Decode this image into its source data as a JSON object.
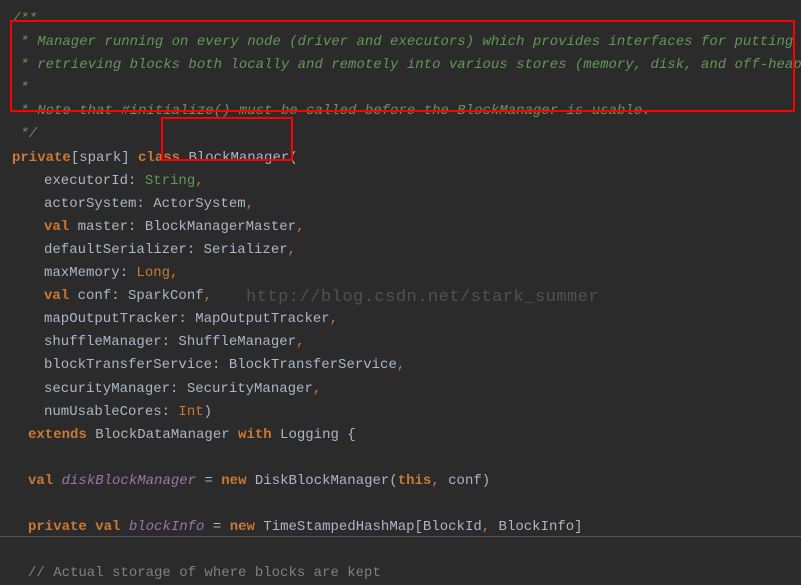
{
  "code": {
    "doc_open": "/**",
    "doc_line1": " * Manager running on every node (driver and executors) which provides interfaces for putting and",
    "doc_line2": " * retrieving blocks both locally and remotely into various stores (memory, disk, and off-heap).",
    "doc_line3": " *",
    "doc_line4": " * Note that #initialize() must be called before the BlockManager is usable.",
    "doc_close": " */",
    "kw_private": "private",
    "spark_scope": "[spark] ",
    "kw_class": "class",
    "class_name": " BlockManager(",
    "param1_name": "executorId: ",
    "param1_type": "String",
    "comma": ",",
    "param2": "actorSystem: ActorSystem",
    "kw_val": "val",
    "param3": " master: BlockManagerMaster",
    "param4": "defaultSerializer: Serializer",
    "param5_name": "maxMemory: ",
    "param5_type": "Long",
    "param6": " conf: SparkConf",
    "param7": "mapOutputTracker: MapOutputTracker",
    "param8": "shuffleManager: ShuffleManager",
    "param9": "blockTransferService: BlockTransferService",
    "param10": "securityManager: SecurityManager",
    "param11_name": "numUsableCores: ",
    "param11_type": "Int",
    "close_paren": ")",
    "kw_extends": "extends",
    "extends_target": " BlockDataManager ",
    "kw_with": "with",
    "with_target": " Logging {",
    "field1_name": "diskBlockManager",
    "equals": " = ",
    "kw_new": "new",
    "disk_ctor": " DiskBlockManager(",
    "kw_this": "this",
    "disk_ctor_end": " conf)",
    "field2_name": "blockInfo",
    "ts_ctor": " TimeStampedHashMap[BlockId",
    "ts_ctor_end": " BlockInfo]",
    "comment_storage": "// Actual storage of where blocks are kept"
  },
  "watermark": "http://blog.csdn.net/stark_summer"
}
